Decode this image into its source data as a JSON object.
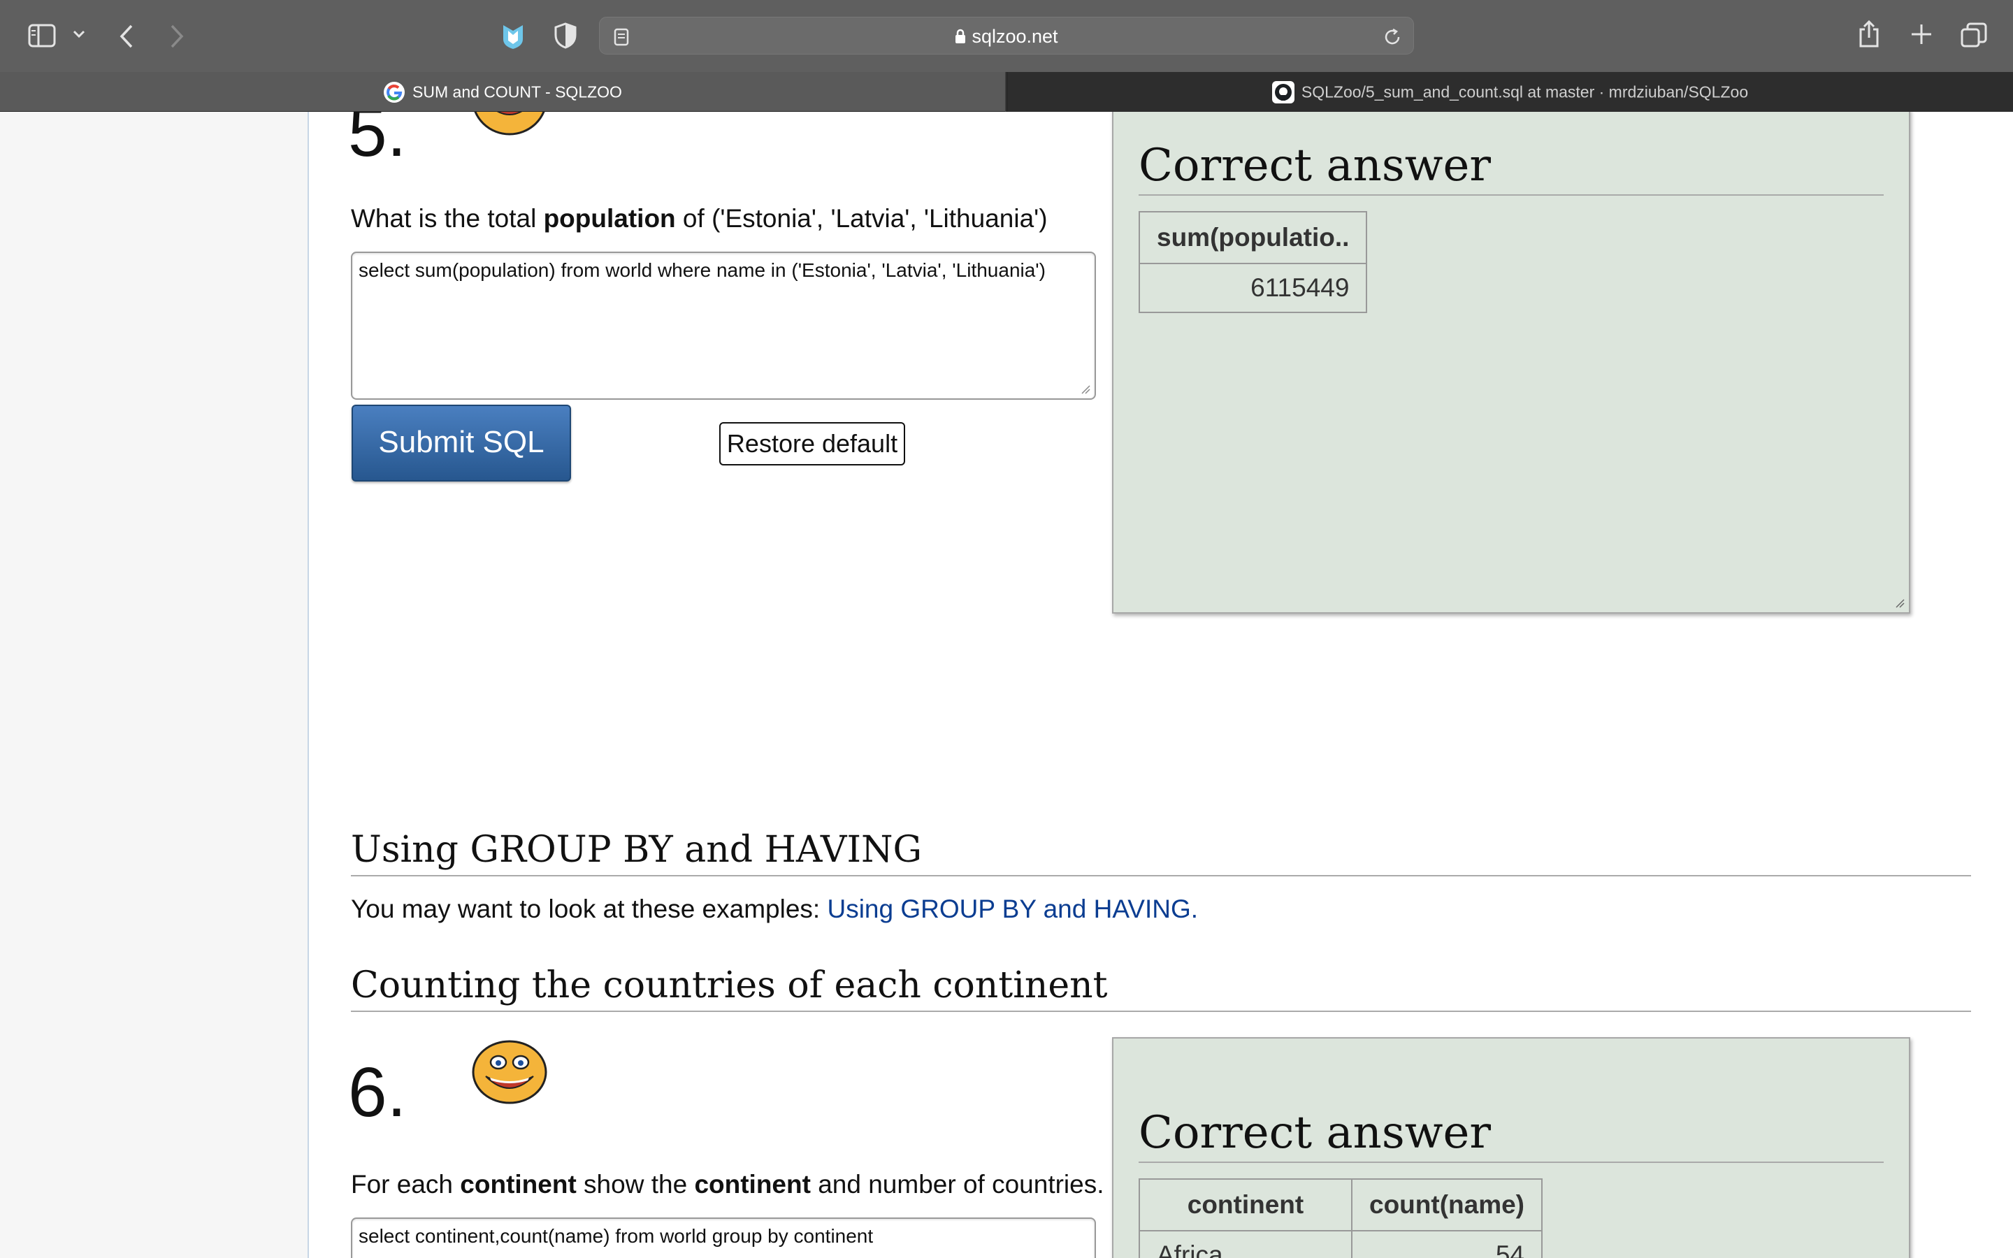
{
  "browser": {
    "url": "sqlzoo.net",
    "tabs": [
      {
        "title": "SUM and COUNT - SQLZOO",
        "active": true,
        "favicon": "google-icon"
      },
      {
        "title": "SQLZoo/5_sum_and_count.sql at master · mrdziuban/SQLZoo",
        "active": false,
        "favicon": "github-icon"
      }
    ]
  },
  "q5": {
    "number": "5.",
    "prompt_pre": "What is the total ",
    "prompt_bold": "population",
    "prompt_post": " of ('Estonia', 'Latvia', 'Lithuania')",
    "sql": "select sum(population) from world where name in ('Estonia', 'Latvia', 'Lithuania')",
    "submit_label": "Submit SQL",
    "restore_label": "Restore default",
    "answer_title": "Correct answer",
    "table": {
      "headers": [
        "sum(populatio.."
      ],
      "rows": [
        [
          "6115449"
        ]
      ]
    }
  },
  "section_group": {
    "heading": "Using GROUP BY and HAVING",
    "text": "You may want to look at these examples: ",
    "link": "Using GROUP BY and HAVING."
  },
  "section_count": {
    "heading": "Counting the countries of each continent"
  },
  "q6": {
    "number": "6.",
    "prompt_pre": "For each ",
    "prompt_bold1": "continent",
    "prompt_mid": " show the ",
    "prompt_bold2": "continent",
    "prompt_post": " and number of countries.",
    "sql": "select continent,count(name) from world group by continent",
    "answer_title": "Correct answer",
    "table": {
      "headers": [
        "continent",
        "count(name)"
      ],
      "rows": [
        [
          "Africa",
          "54"
        ]
      ]
    }
  },
  "colors": {
    "answer_bg": "#dce5dc",
    "submit_bg": "#2f6aa8",
    "link": "#0b3d91"
  }
}
